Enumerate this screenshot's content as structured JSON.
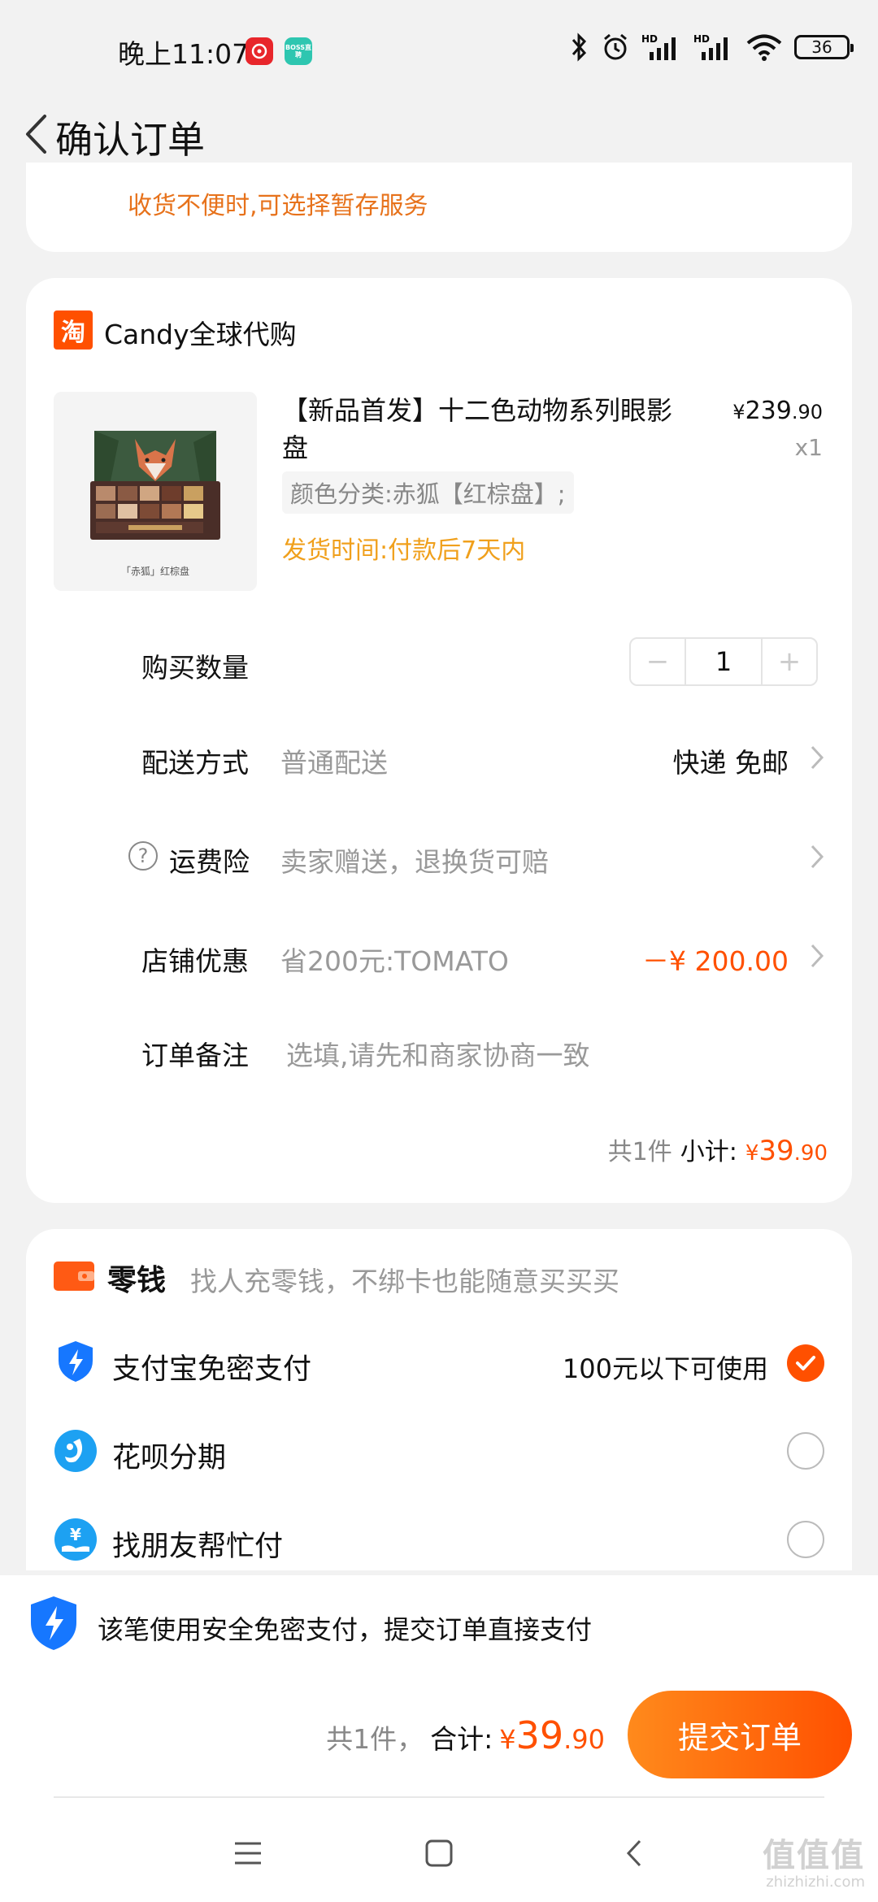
{
  "status_bar": {
    "time": "晚上11:07",
    "app_badge_2": "BOSS直聘",
    "battery": "36"
  },
  "header": {
    "title": "确认订单"
  },
  "notice": {
    "text": "收货不便时,可选择暂存服务"
  },
  "shop": {
    "logo_char": "淘",
    "name": "Candy全球代购"
  },
  "product": {
    "image_caption": "「赤狐」红棕盘",
    "title": "【新品首发】十二色动物系列眼影盘",
    "price_yen": "¥",
    "price_int": "239",
    "price_dec": ".90",
    "quantity": "x1",
    "sku": "颜色分类:赤狐【红棕盘】;",
    "ship_time": "发货时间:付款后7天内"
  },
  "rows": {
    "quantity_label": "购买数量",
    "quantity_value": "1",
    "stepper_minus": "−",
    "stepper_plus": "+",
    "delivery_label": "配送方式",
    "delivery_value": "普通配送",
    "delivery_right": "快递 免邮",
    "insurance_label": "运费险",
    "insurance_value": "卖家赠送，退换货可赔",
    "help_char": "?",
    "discount_label": "店铺优惠",
    "discount_value": "省200元:TOMATO",
    "discount_amount": "－¥ 200.00",
    "remark_label": "订单备注",
    "remark_placeholder": "选填,请先和商家协商一致"
  },
  "subtotal": {
    "count": "共1件",
    "label": "小计:",
    "yen": "¥",
    "int": "39",
    "dec": ".90"
  },
  "payment": {
    "wallet_label": "零钱",
    "wallet_desc": "找人充零钱，不绑卡也能随意买买买",
    "options": [
      {
        "label": "支付宝免密支付",
        "note": "100元以下可使用",
        "selected": true
      },
      {
        "label": "花呗分期",
        "note": "",
        "selected": false
      },
      {
        "label": "找朋友帮忙付",
        "note": "",
        "selected": false
      }
    ]
  },
  "footer": {
    "security_text": "该笔使用安全免密支付，提交订单直接支付",
    "total_count": "共1件，",
    "total_label": "合计:",
    "total_yen": "¥",
    "total_int": "39",
    "total_dec": ".90",
    "submit_label": "提交订单"
  },
  "watermark": {
    "main": "值值值",
    "sub": "zhizhizhi.com"
  },
  "colors": {
    "accent": "#ff5000",
    "notice": "#e7721b",
    "ship": "#f0a01c"
  }
}
